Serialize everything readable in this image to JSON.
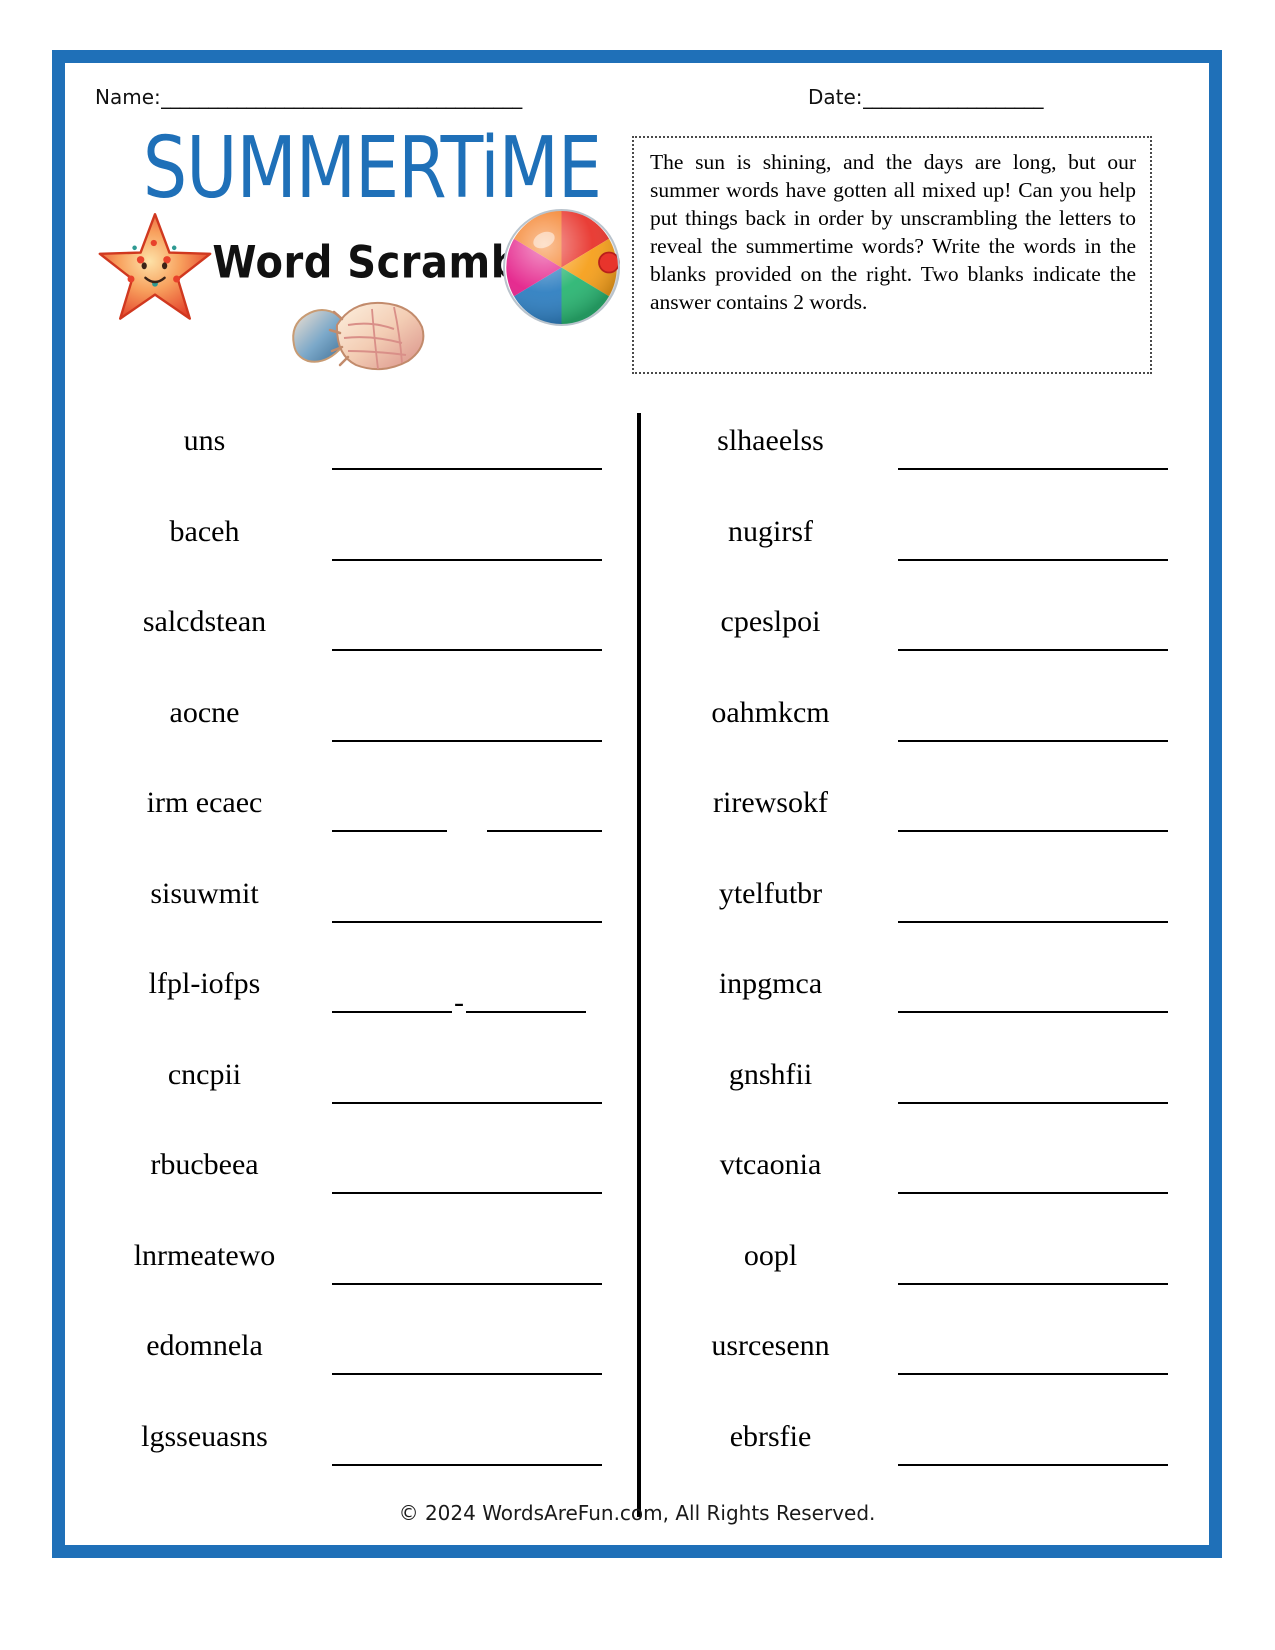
{
  "frame": {
    "border_color": "#1f70b8"
  },
  "header": {
    "name_label": "Name:",
    "name_rule": "______________________________________",
    "date_label": "Date:",
    "date_rule": "___________________"
  },
  "title": {
    "main": "SUMMERTiME",
    "sub": "Word Scramble",
    "main_color": "#1f70b8",
    "sub_color": "#111111"
  },
  "decorations": [
    {
      "name": "starfish-image",
      "label": "starfish"
    },
    {
      "name": "seashell-image",
      "label": "seashell"
    },
    {
      "name": "beachball-image",
      "label": "beach ball"
    }
  ],
  "instructions": {
    "text": "The sun is shining, and the days are long, but our summer words have gotten all mixed up! Can you help put things back in order by unscrambling the letters to reveal the summertime words? Write the words in the blanks provided on the right. Two blanks indicate the answer contains 2 words."
  },
  "puzzle": {
    "left_column": [
      {
        "scramble": "uns",
        "blank_type": "single"
      },
      {
        "scramble": "baceh",
        "blank_type": "single"
      },
      {
        "scramble": "salcdstean",
        "blank_type": "single"
      },
      {
        "scramble": "aocne",
        "blank_type": "single"
      },
      {
        "scramble": "irm ecaec",
        "blank_type": "two"
      },
      {
        "scramble": "sisuwmit",
        "blank_type": "single"
      },
      {
        "scramble": "lfpl-iofps",
        "blank_type": "hyphen",
        "separator": "-"
      },
      {
        "scramble": "cncpii",
        "blank_type": "single"
      },
      {
        "scramble": "rbucbeea",
        "blank_type": "single"
      },
      {
        "scramble": "lnrmeatewo",
        "blank_type": "single"
      },
      {
        "scramble": "edomnela",
        "blank_type": "single"
      },
      {
        "scramble": "lgsseuasns",
        "blank_type": "single"
      }
    ],
    "right_column": [
      {
        "scramble": "slhaeelss",
        "blank_type": "single"
      },
      {
        "scramble": "nugirsf",
        "blank_type": "single"
      },
      {
        "scramble": "cpeslpoi",
        "blank_type": "single"
      },
      {
        "scramble": "oahmkcm",
        "blank_type": "single"
      },
      {
        "scramble": "rirewsokf",
        "blank_type": "single"
      },
      {
        "scramble": "ytelfutbr",
        "blank_type": "single"
      },
      {
        "scramble": "inpgmca",
        "blank_type": "single"
      },
      {
        "scramble": "gnshfii",
        "blank_type": "single"
      },
      {
        "scramble": "vtcaonia",
        "blank_type": "single"
      },
      {
        "scramble": "oopl",
        "blank_type": "single"
      },
      {
        "scramble": "usrcesenn",
        "blank_type": "single"
      },
      {
        "scramble": "ebrsfie",
        "blank_type": "single"
      }
    ]
  },
  "footer": {
    "copyright": "© 2024 WordsAreFun.com, All Rights Reserved."
  }
}
